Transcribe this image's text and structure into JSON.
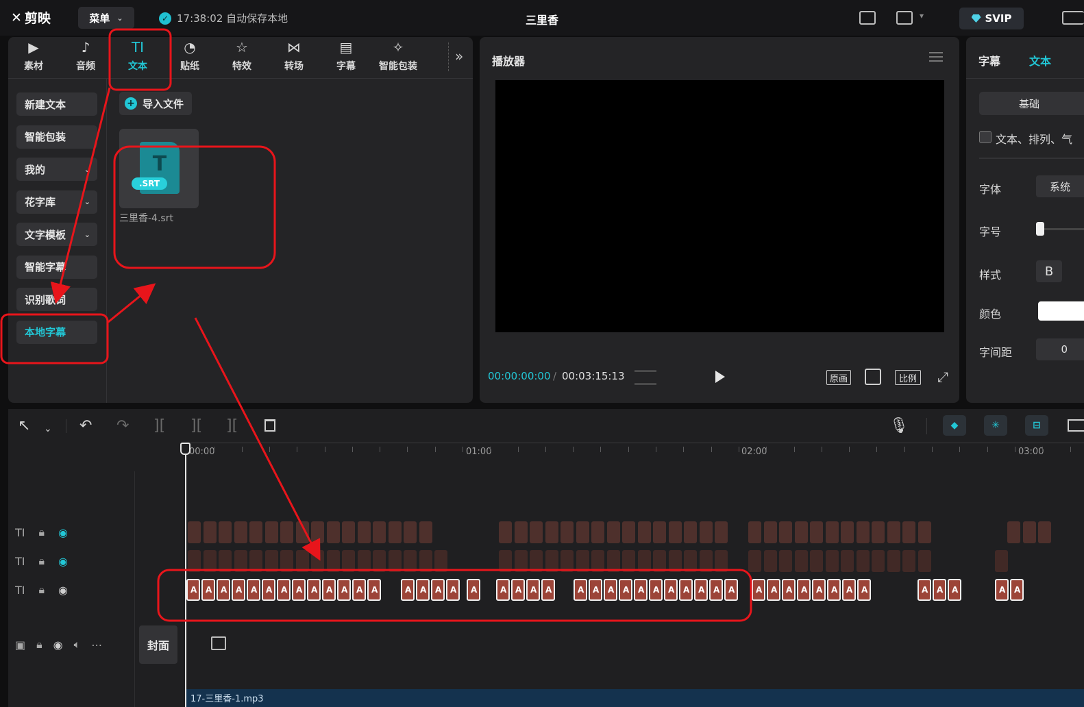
{
  "titlebar": {
    "logo_label": "剪映",
    "menu_label": "菜单",
    "autosave_text": "17:38:02 自动保存本地",
    "project_title": "三里香",
    "svip_label": "SVIP"
  },
  "categories": [
    {
      "label": "素材",
      "icon": "▶"
    },
    {
      "label": "音频",
      "icon": "♪"
    },
    {
      "label": "文本",
      "icon": "TI",
      "active": true
    },
    {
      "label": "贴纸",
      "icon": "◔"
    },
    {
      "label": "特效",
      "icon": "☆"
    },
    {
      "label": "转场",
      "icon": "⋈"
    },
    {
      "label": "字幕",
      "icon": "▤"
    },
    {
      "label": "智能包装",
      "icon": "✧"
    }
  ],
  "sidebar": {
    "items": [
      {
        "label": "新建文本"
      },
      {
        "label": "智能包装"
      },
      {
        "label": "我的",
        "chevron": true
      },
      {
        "label": "花字库",
        "chevron": true
      },
      {
        "label": "文字模板",
        "chevron": true
      },
      {
        "label": "智能字幕"
      },
      {
        "label": "识别歌词"
      },
      {
        "label": "本地字幕",
        "active": true
      }
    ]
  },
  "content": {
    "import_label": "导入文件",
    "file": {
      "badge": ".SRT",
      "glyph": "T",
      "name": "三里香-4.srt"
    }
  },
  "player": {
    "title": "播放器",
    "current_time": "00:00:00:00",
    "separator": "/",
    "total_time": "00:03:15:13",
    "btn_original": "原画",
    "btn_ratio": "比例"
  },
  "right_panel": {
    "tab_subtitle": "字幕",
    "tab_text": "文本",
    "basic_label": "基础",
    "checkbox_label": "文本、排列、气",
    "font_label": "字体",
    "font_value": "系统",
    "size_label": "字号",
    "style_label": "样式",
    "bold_label": "B",
    "color_label": "颜色",
    "spacing_label": "字间距",
    "spacing_value": "0"
  },
  "timeline": {
    "ticks": [
      "00:00",
      "01:00",
      "02:00",
      "03:00"
    ],
    "cover_label": "封面",
    "audio_clip_name": "17-三里香-1.mp3",
    "clip_glyph": "A"
  },
  "colors": {
    "accent": "#22c7d6",
    "clip": "#9c4438",
    "annotation": "#e8151b"
  }
}
